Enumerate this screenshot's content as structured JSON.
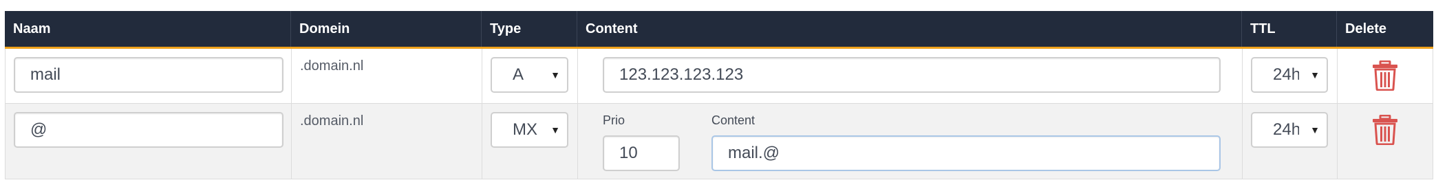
{
  "headers": {
    "naam": "Naam",
    "domein": "Domein",
    "type": "Type",
    "content": "Content",
    "ttl": "TTL",
    "delete": "Delete"
  },
  "rows": [
    {
      "naam": "mail",
      "domein": ".domain.nl",
      "type": "A",
      "content": "123.123.123.123",
      "ttl": "24h"
    },
    {
      "naam": "@",
      "domein": ".domain.nl",
      "type": "MX",
      "prio_label": "Prio",
      "prio": "10",
      "content_label": "Content",
      "content": "mail.@",
      "ttl": "24h"
    }
  ],
  "colors": {
    "header_bg": "#222b3c",
    "header_underline": "#f0a21b",
    "delete_icon": "#d9534f"
  },
  "icons": {
    "delete": "trash-icon",
    "select_caret": "caret-down-icon"
  }
}
